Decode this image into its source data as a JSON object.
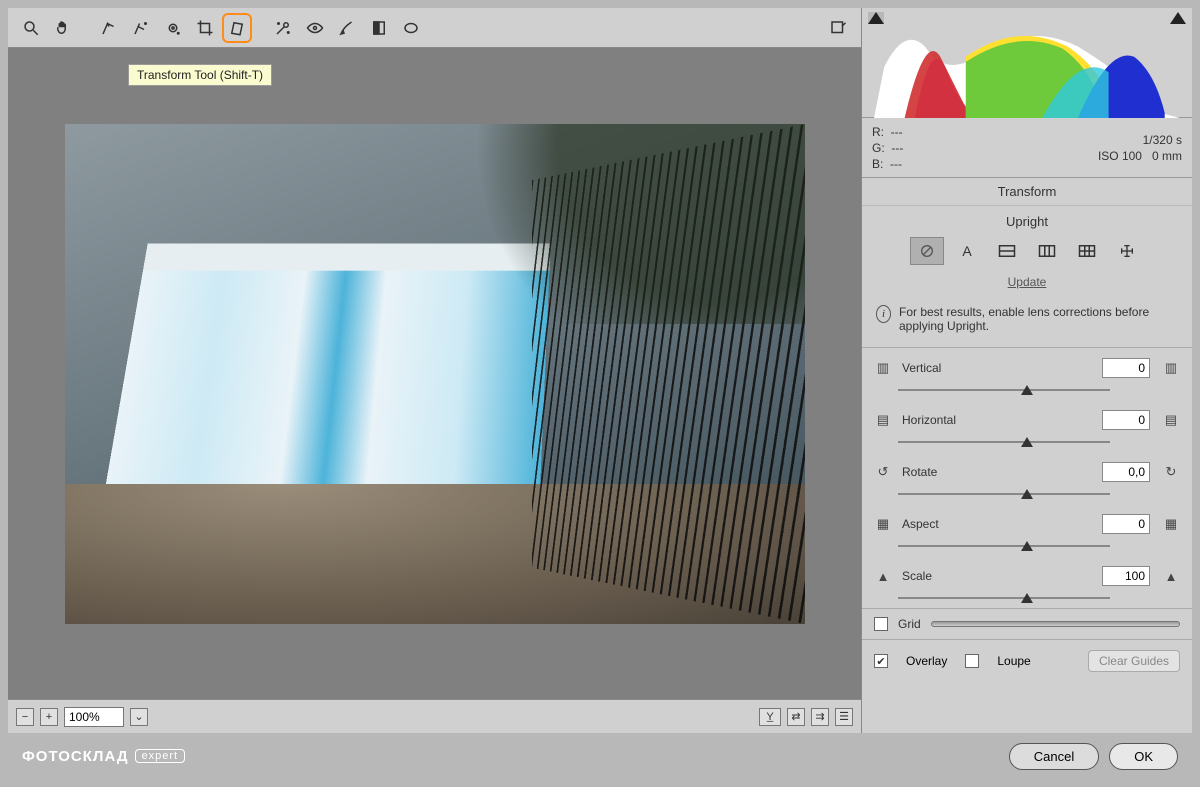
{
  "toolbar": {
    "tooltip": "Transform Tool (Shift-T)"
  },
  "status": {
    "zoom": "100%",
    "minus": "−",
    "plus": "+"
  },
  "info": {
    "r_label": "R:",
    "g_label": "G:",
    "b_label": "B:",
    "r_val": "---",
    "g_val": "---",
    "b_val": "---",
    "shutter": "1/320 s",
    "iso": "ISO 100",
    "focal": "0 mm"
  },
  "panel": {
    "title": "Transform",
    "upright_title": "Upright",
    "upright_options": {
      "auto": "A"
    },
    "update": "Update",
    "tip": "For best results, enable lens corrections before applying Upright."
  },
  "sliders": {
    "vertical": {
      "label": "Vertical",
      "value": "0"
    },
    "horizontal": {
      "label": "Horizontal",
      "value": "0"
    },
    "rotate": {
      "label": "Rotate",
      "value": "0,0"
    },
    "aspect": {
      "label": "Aspect",
      "value": "0"
    },
    "scale": {
      "label": "Scale",
      "value": "100"
    }
  },
  "grid": {
    "label": "Grid"
  },
  "overlay": {
    "overlay_label": "Overlay",
    "loupe_label": "Loupe",
    "clear": "Clear Guides"
  },
  "footer": {
    "brand": "ФОТОСКЛАД",
    "brand_sub": "expert",
    "cancel": "Cancel",
    "ok": "OK"
  }
}
